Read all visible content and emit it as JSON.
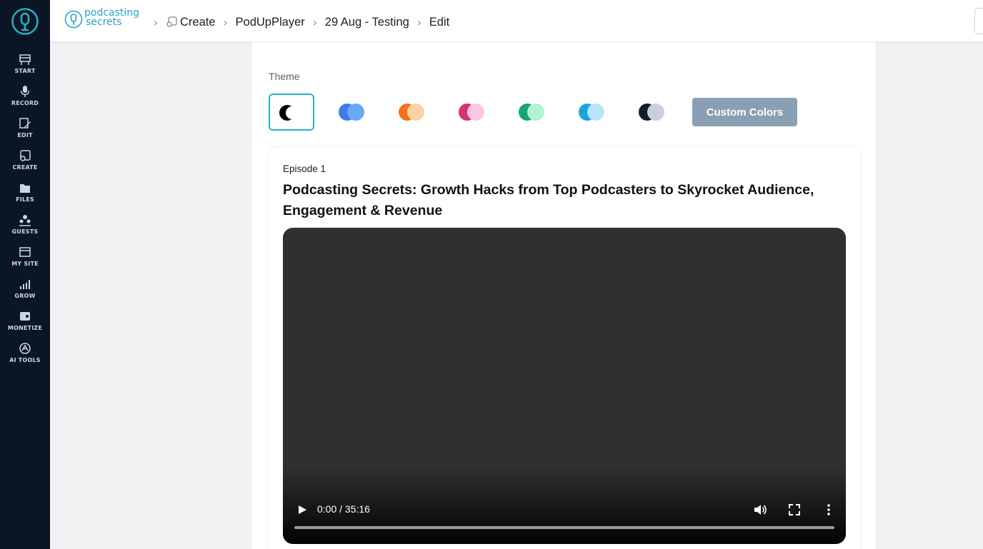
{
  "colors": {
    "sidebar_bg": "#0b1624",
    "accent": "#2bb0c9",
    "custom_button_bg": "#8a9fb3",
    "video_bg": "#303030"
  },
  "sidebar": {
    "logo_icon": "podcast-mic-logo-icon",
    "items": [
      {
        "label": "START",
        "icon": "start-icon"
      },
      {
        "label": "RECORD",
        "icon": "microphone-icon"
      },
      {
        "label": "EDIT",
        "icon": "edit-icon"
      },
      {
        "label": "CREATE",
        "icon": "create-icon"
      },
      {
        "label": "FILES",
        "icon": "files-icon"
      },
      {
        "label": "GUESTS",
        "icon": "guests-icon"
      },
      {
        "label": "MY SITE",
        "icon": "my-site-icon"
      },
      {
        "label": "GROW",
        "icon": "grow-icon"
      },
      {
        "label": "MONETIZE",
        "icon": "monetize-icon"
      },
      {
        "label": "AI TOOLS",
        "icon": "ai-tools-icon"
      }
    ]
  },
  "header": {
    "brand_line1": "podcasting",
    "brand_line2": "secrets",
    "breadcrumbs": [
      "Create",
      "PodUpPlayer",
      "29 Aug - Testing",
      "Edit"
    ]
  },
  "theme": {
    "label": "Theme",
    "swatches": [
      {
        "name": "dark-moon",
        "colors": [
          "#000000",
          "#ffffff"
        ],
        "selected": true
      },
      {
        "name": "blue",
        "colors": [
          "#3b7fe6",
          "#6aa7f5"
        ]
      },
      {
        "name": "orange",
        "colors": [
          "#f0761d",
          "#fbd2a6"
        ]
      },
      {
        "name": "pink",
        "colors": [
          "#d6336c",
          "#f9c8e0"
        ]
      },
      {
        "name": "green",
        "colors": [
          "#16a66e",
          "#b5f1d3"
        ]
      },
      {
        "name": "sky",
        "colors": [
          "#1aa3dc",
          "#b9e3f9"
        ]
      },
      {
        "name": "slate",
        "colors": [
          "#141d2b",
          "#c9d0db"
        ]
      }
    ],
    "custom_button_label": "Custom Colors"
  },
  "episode": {
    "number_label": "Episode 1",
    "title": "Podcasting Secrets: Growth Hacks from Top Podcasters to Skyrocket Audience, Engagement & Revenue",
    "player": {
      "time": "0:00 / 35:16",
      "progress": 0
    }
  }
}
